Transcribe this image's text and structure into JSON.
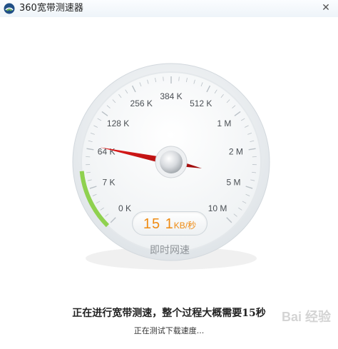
{
  "window": {
    "title": "360宽带测速器",
    "close_glyph": "✕"
  },
  "gauge": {
    "tick_labels": [
      "0 K",
      "7 K",
      "64 K",
      "128 K",
      "256 K",
      "384 K",
      "512 K",
      "1 M",
      "2 M",
      "5 M",
      "10 M"
    ],
    "needle_tick_position": 2.1,
    "speed_value": "15 1",
    "speed_unit": "KB/秒",
    "caption": "即时网速",
    "accent_color": "#ef8b12",
    "needle_color": "#cc1111",
    "progress_color": "#8fd14f"
  },
  "status": {
    "main": "正在进行宽带测速，整个过程大概需要15秒",
    "sub": "正在测试下载速度..."
  },
  "watermark": "Bai 经验",
  "icons": {
    "logo": "360-logo-icon",
    "close": "close-icon"
  }
}
